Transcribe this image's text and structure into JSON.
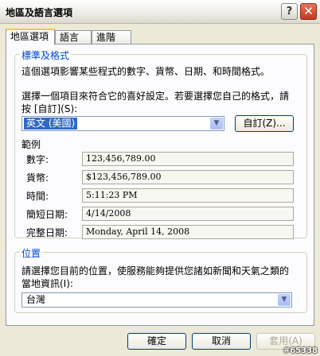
{
  "window": {
    "title": "地區及語言選項",
    "help_glyph": "?",
    "close_glyph": "✕"
  },
  "tabs": [
    {
      "label": "地區選項",
      "active": true
    },
    {
      "label": "語言",
      "active": false
    },
    {
      "label": "進階",
      "active": false
    }
  ],
  "standards_group": {
    "legend": "標準及格式",
    "description": "這個選項影響某些程式的數字、貨幣、日期、和時間格式。",
    "prompt_line1": "選擇一個項目來符合它的喜好設定。若要選擇您自己的格式，請",
    "prompt_line2": "按 [自訂](S):",
    "locale_value": "英文 (美國)",
    "customize_label": "自訂(Z)...",
    "samples_heading": "範例",
    "samples": [
      {
        "label": "數字:",
        "value": "123,456,789.00"
      },
      {
        "label": "貨幣:",
        "value": "$123,456,789.00"
      },
      {
        "label": "時間:",
        "value": "5:11:23 PM"
      },
      {
        "label": "簡短日期:",
        "value": "4/14/2008"
      },
      {
        "label": "完整日期:",
        "value": "Monday, April 14, 2008"
      }
    ]
  },
  "location_group": {
    "legend": "位置",
    "prompt_line1": "請選擇您目前的位置，使服務能夠提供您諸如新聞和天氣之類的",
    "prompt_line2": "當地資訊(I):",
    "location_value": "台灣"
  },
  "buttons": {
    "ok": "確定",
    "cancel": "取消",
    "apply": "套用(A)"
  },
  "watermark": "#65338"
}
